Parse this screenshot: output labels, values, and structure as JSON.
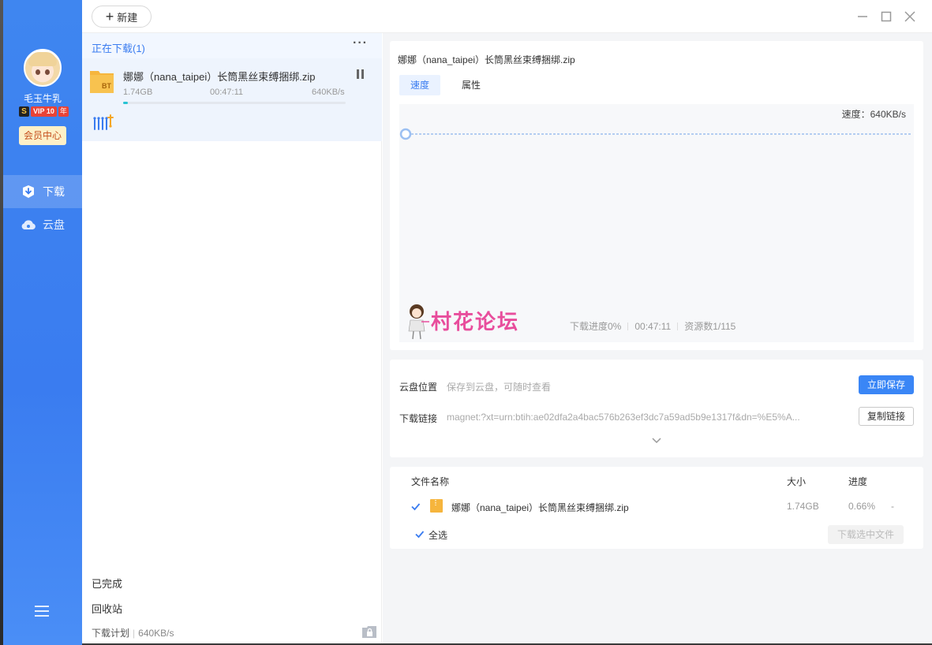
{
  "sidebar": {
    "username": "毛玉牛乳",
    "vip_s": "S",
    "vip_level": "VIP 10",
    "vip_year": "年",
    "vip_center": "会员中心",
    "nav": [
      {
        "label": "下载",
        "icon": "download-shield-icon"
      },
      {
        "label": "云盘",
        "icon": "cloud-icon"
      }
    ]
  },
  "toolbar": {
    "new_label": "新建"
  },
  "list": {
    "header_title": "正在下载(1)",
    "more": "···",
    "task": {
      "name": "娜娜（nana_taipei）长筒黑丝束缚捆绑.zip",
      "icon_badge": "BT",
      "size": "1.74GB",
      "time": "00:47:11",
      "speed": "640KB/s",
      "progress": 0.0066
    },
    "completed": "已完成",
    "recycle": "回收站",
    "plan_label": "下载计划",
    "plan_speed": "640KB/s"
  },
  "detail": {
    "title": "娜娜（nana_taipei）长筒黑丝束缚捆绑.zip",
    "tabs": [
      "速度",
      "属性"
    ],
    "speed_label": "速度：640KB/s",
    "stats": {
      "progress": "下载进度0%",
      "time": "00:47:11",
      "sources": "资源数1/115"
    },
    "watermark": "村花论坛",
    "cloud_label": "云盘位置",
    "cloud_value": "保存到云盘，可随时查看",
    "save_now": "立即保存",
    "link_label": "下载链接",
    "link_value": "magnet:?xt=urn:btih:ae02dfa2a4bac576b263ef3dc7a59ad5b9e1317f&dn=%E5%A...",
    "copy_link": "复制链接"
  },
  "files": {
    "headers": {
      "name": "文件名称",
      "size": "大小",
      "progress": "进度"
    },
    "rows": [
      {
        "name": "娜娜（nana_taipei）长筒黑丝束缚捆绑.zip",
        "size": "1.74GB",
        "progress": "0.66%",
        "extra": "-"
      }
    ],
    "select_all": "全选",
    "download_selected": "下载选中文件"
  },
  "colors": {
    "accent": "#3a7cf0",
    "sidebar": "#3f86f0",
    "progress": "#28c3d4",
    "watermark": "#e84d9c"
  }
}
